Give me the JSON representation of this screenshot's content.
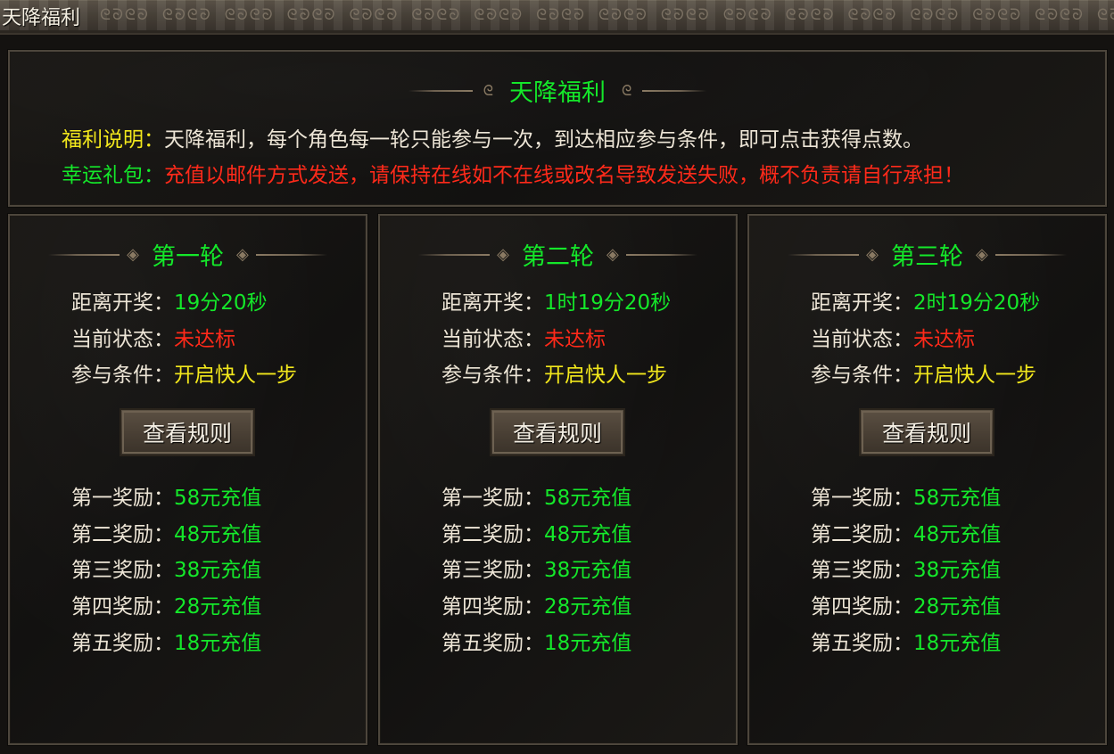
{
  "window": {
    "title": "天降福利"
  },
  "header": {
    "title": "天降福利",
    "desc_label": "福利说明：",
    "desc_text": "天降福利，每个角色每一轮只能参与一次，到达相应参与条件，即可点击获得点数。",
    "gift_label": "幸运礼包：",
    "gift_text": "充值以邮件方式发送，请保持在线如不在线或改名导致发送失败，概不负责请自行承担！"
  },
  "rounds": [
    {
      "title": "第一轮",
      "countdown_label": "距离开奖：",
      "countdown": "19分20秒",
      "status_label": "当前状态：",
      "status": "未达标",
      "condition_label": "参与条件：",
      "condition": "开启快人一步",
      "button_label": "查看规则",
      "rewards": [
        {
          "label": "第一奖励：",
          "value": "58元充值"
        },
        {
          "label": "第二奖励：",
          "value": "48元充值"
        },
        {
          "label": "第三奖励：",
          "value": "38元充值"
        },
        {
          "label": "第四奖励：",
          "value": "28元充值"
        },
        {
          "label": "第五奖励：",
          "value": "18元充值"
        }
      ]
    },
    {
      "title": "第二轮",
      "countdown_label": "距离开奖：",
      "countdown": "1时19分20秒",
      "status_label": "当前状态：",
      "status": "未达标",
      "condition_label": "参与条件：",
      "condition": "开启快人一步",
      "button_label": "查看规则",
      "rewards": [
        {
          "label": "第一奖励：",
          "value": "58元充值"
        },
        {
          "label": "第二奖励：",
          "value": "48元充值"
        },
        {
          "label": "第三奖励：",
          "value": "38元充值"
        },
        {
          "label": "第四奖励：",
          "value": "28元充值"
        },
        {
          "label": "第五奖励：",
          "value": "18元充值"
        }
      ]
    },
    {
      "title": "第三轮",
      "countdown_label": "距离开奖：",
      "countdown": "2时19分20秒",
      "status_label": "当前状态：",
      "status": "未达标",
      "condition_label": "参与条件：",
      "condition": "开启快人一步",
      "button_label": "查看规则",
      "rewards": [
        {
          "label": "第一奖励：",
          "value": "58元充值"
        },
        {
          "label": "第二奖励：",
          "value": "48元充值"
        },
        {
          "label": "第三奖励：",
          "value": "38元充值"
        },
        {
          "label": "第四奖励：",
          "value": "28元充值"
        },
        {
          "label": "第五奖励：",
          "value": "18元充值"
        }
      ]
    }
  ],
  "colors": {
    "highlight_green": "#14e82a",
    "warning_red": "#ff2a1a",
    "label_yellow": "#f2e71c",
    "text_white": "#ede5d6"
  },
  "icons": {
    "title_ornament": "scroll-pattern-icon",
    "heading_ornament": "swirl-icon",
    "round_ornament": "diamond-icon"
  }
}
